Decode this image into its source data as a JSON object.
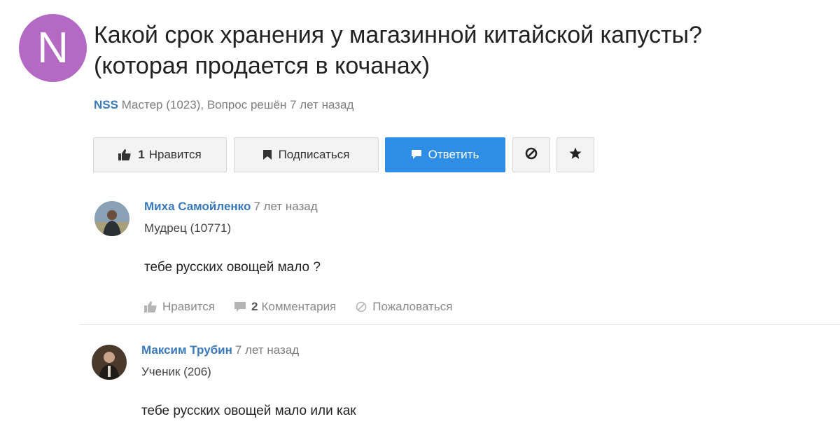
{
  "question": {
    "avatar_letter": "N",
    "avatar_color": "#b46ac3",
    "title_line1": "Какой срок хранения у магазинной китайской капусты?",
    "title_line2": "(которая продается в кочанах)",
    "author": "NSS",
    "meta": "Мастер (1023), Вопрос решён 7 лет назад"
  },
  "actions": {
    "like_count": "1",
    "like_label": "Нравится",
    "subscribe_label": "Подписаться",
    "answer_label": "Ответить",
    "block_icon": "block-icon",
    "star_icon": "star-icon",
    "accent_color": "#2e8de4"
  },
  "answers": [
    {
      "name": "Миха Самойленко",
      "time": "7 лет назад",
      "rank": "Мудрец (10771)",
      "text": "тебе русских овощей мало ?",
      "like_label": "Нравится",
      "comments_count": "2",
      "comments_label": "Комментария",
      "report_label": "Пожаловаться"
    },
    {
      "name": "Максим Трубин",
      "time": "7 лет назад",
      "rank": "Ученик (206)",
      "text": "тебе русских овощей мало или как"
    }
  ],
  "colors": {
    "link": "#3a79b9",
    "muted": "#7d7d7d"
  }
}
